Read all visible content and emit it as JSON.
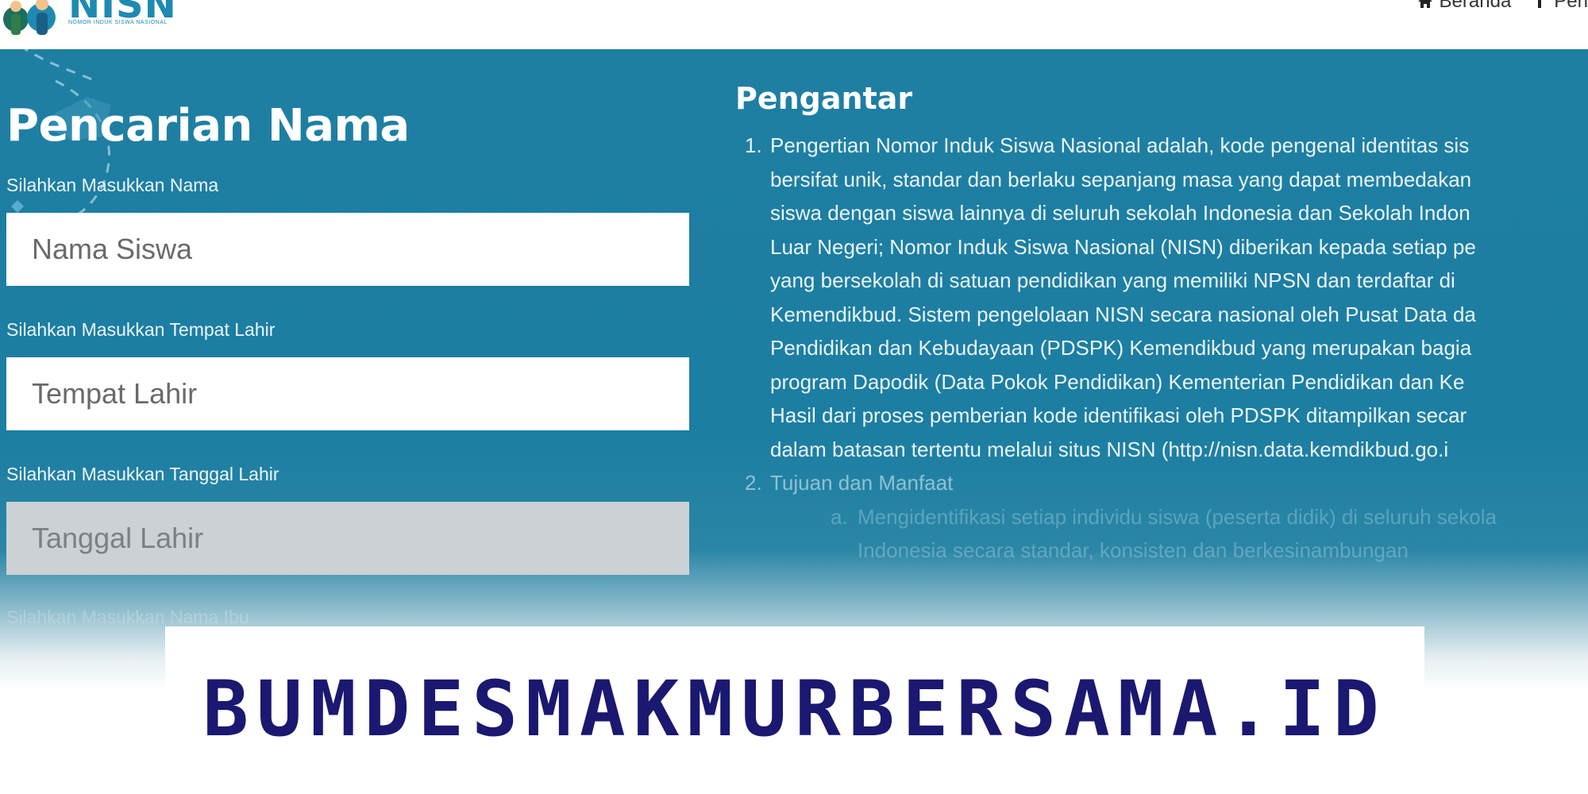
{
  "header": {
    "logo_text": "NISN",
    "logo_subtitle": "NOMOR INDUK SISWA NASIONAL",
    "nav": [
      {
        "label": "Beranda",
        "icon": "home-icon"
      },
      {
        "label": "Pen",
        "icon": "info-icon"
      }
    ]
  },
  "search": {
    "title": "Pencarian Nama",
    "fields": [
      {
        "label": "Silahkan Masukkan Nama",
        "placeholder": "Nama Siswa"
      },
      {
        "label": "Silahkan Masukkan Tempat Lahir",
        "placeholder": "Tempat Lahir"
      },
      {
        "label": "Silahkan Masukkan Tanggal Lahir",
        "placeholder": "Tanggal Lahir"
      },
      {
        "label": "Silahkan Masukkan Nama Ibu"
      }
    ]
  },
  "intro": {
    "title": "Pengantar",
    "items": [
      {
        "number": "1.",
        "lines": [
          "Pengertian Nomor Induk Siswa Nasional adalah, kode pengenal identitas sis",
          "bersifat unik, standar dan berlaku sepanjang masa yang dapat membedakan",
          "siswa dengan siswa lainnya di seluruh sekolah Indonesia dan Sekolah Indon",
          "Luar Negeri; Nomor Induk Siswa Nasional (NISN) diberikan kepada setiap pe",
          "yang bersekolah di satuan pendidikan yang memiliki NPSN dan terdaftar di",
          "Kemendikbud. Sistem pengelolaan NISN secara nasional oleh Pusat Data da",
          "Pendidikan dan Kebudayaan (PDSPK) Kemendikbud yang merupakan bagia",
          "program Dapodik (Data Pokok Pendidikan) Kementerian Pendidikan dan Ke",
          "Hasil dari proses pemberian kode identifikasi oleh PDSPK ditampilkan secar",
          "dalam batasan tertentu melalui situs NISN (http://nisn.data.kemdikbud.go.i"
        ]
      },
      {
        "number": "2.",
        "lines": [
          "Tujuan dan Manfaat"
        ],
        "sub": {
          "number": "a.",
          "lines": [
            "Mengidentifikasi setiap individu siswa (peserta didik) di seluruh sekola",
            "Indonesia secara standar, konsisten dan berkesinambungan"
          ]
        }
      }
    ]
  },
  "watermark": "BUMDESMAKMURBERSAMA.ID",
  "colors": {
    "hero": "#1e7fa3",
    "brand": "#1e8ab2",
    "watermark": "#1a1870"
  }
}
